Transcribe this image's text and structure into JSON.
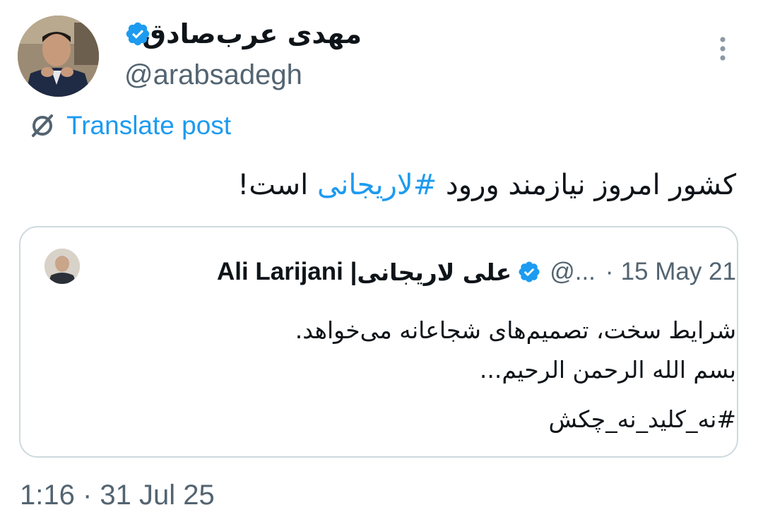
{
  "author": {
    "display_name": "مهدی عرب‌صادق",
    "handle": "@arabsadegh",
    "verified": true,
    "avatar_icon": "person-photo"
  },
  "translate": {
    "label": "Translate post",
    "icon": "translate-icon"
  },
  "tweet": {
    "text_before_hashtag": "کشور امروز نیازمند ورود ",
    "hashtag": "#لاریجانی",
    "text_after_hashtag": " است!"
  },
  "quote": {
    "name_en": "Ali Larijani | ",
    "name_fa": "علی لاریجانی",
    "handle": "@...",
    "separator": "·",
    "date": "15 May 21",
    "body_lines": [
      "شرایط سخت، تصمیم‌های شجاعانه می‌خواهد.",
      "بسم الله الرحمن الرحیم...",
      "#نه_کلید_نه_چکش"
    ]
  },
  "timestamp": "1:16 · 31 Jul 25",
  "colors": {
    "accent": "#1d9bf0",
    "muted": "#536471",
    "border": "#cfd9de",
    "text": "#0f1419"
  }
}
